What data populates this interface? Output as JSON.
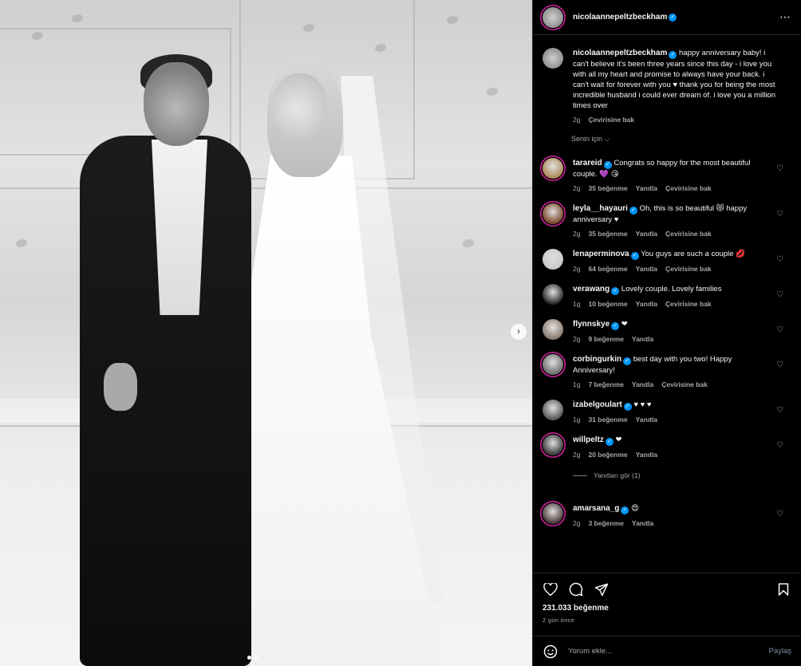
{
  "post": {
    "author": "nicolaannepeltzbeckham",
    "caption": "happy anniversary baby! i can't believe it's been three years since this day - i love you with all my heart and promise to always have your back. i can't wait for forever with you  ♥  thank you for being the most incredible husband i could ever dream of. i love you a million times over",
    "caption_time": "2g",
    "caption_translate": "Çevirisine bak",
    "for_you": "Senin için",
    "likes": "231.033 beğenme",
    "posted_ago": "2 gün önce",
    "comment_placeholder": "Yorum ekle...",
    "share_label": "Paylaş",
    "more_icon": "⋯"
  },
  "comments": [
    {
      "user": "tarareid",
      "text": "Congrats so happy for the most beautiful couple. 💜 😘",
      "time": "2g",
      "likes": "35 beğenme",
      "reply": "Yanıtla",
      "translate": "Çevirisine bak",
      "avatar_color": "#b08a5a"
    },
    {
      "user": "leyla__hayauri",
      "text": "Oh, this is so beautiful 😻 happy anniversary ♥",
      "time": "2g",
      "likes": "35 beğenme",
      "reply": "Yanıtla",
      "translate": "Çevirisine bak",
      "avatar_color": "#7a4a2a"
    },
    {
      "user": "lenaperminova",
      "text": "You guys are such a couple 💋",
      "time": "2g",
      "likes": "64 beğenme",
      "reply": "Yanıtla",
      "translate": "Çevirisine bak",
      "avatar_color": "#c9c9c9"
    },
    {
      "user": "verawang",
      "text": "Lovely couple. Lovely families",
      "time": "1g",
      "likes": "10 beğenme",
      "reply": "Yanıtla",
      "translate": "Çevirisine bak",
      "avatar_color": "#2a2a2a"
    },
    {
      "user": "flynnskye",
      "text": "❤",
      "time": "2g",
      "likes": "9 beğenme",
      "reply": "Yanıtla",
      "translate": "",
      "avatar_color": "#8c7b6e"
    },
    {
      "user": "corbingurkin",
      "text": "best day with you two! Happy Anniversary!",
      "time": "1g",
      "likes": "7 beğenme",
      "reply": "Yanıtla",
      "translate": "Çevirisine bak",
      "avatar_color": "#6e6e6e"
    },
    {
      "user": "izabelgoulart",
      "text": "♥ ♥ ♥",
      "time": "1g",
      "likes": "31 beğenme",
      "reply": "Yanıtla",
      "translate": "",
      "avatar_color": "#5a5a5a"
    },
    {
      "user": "willpeltz",
      "text": "❤",
      "time": "2g",
      "likes": "20 beğenme",
      "reply": "Yanıtla",
      "translate": "",
      "avatar_color": "#3a3a3a"
    },
    {
      "user": "amarsana_g",
      "text": "😍",
      "time": "2g",
      "likes": "3 beğenme",
      "reply": "Yanıtla",
      "translate": "",
      "avatar_color": "#4a3a3a"
    }
  ],
  "replies_link": "Yanıtları gör (1)",
  "colors": {
    "verified": "#0095f6",
    "ring": "#d6249f",
    "muted": "#a8a8a8"
  }
}
